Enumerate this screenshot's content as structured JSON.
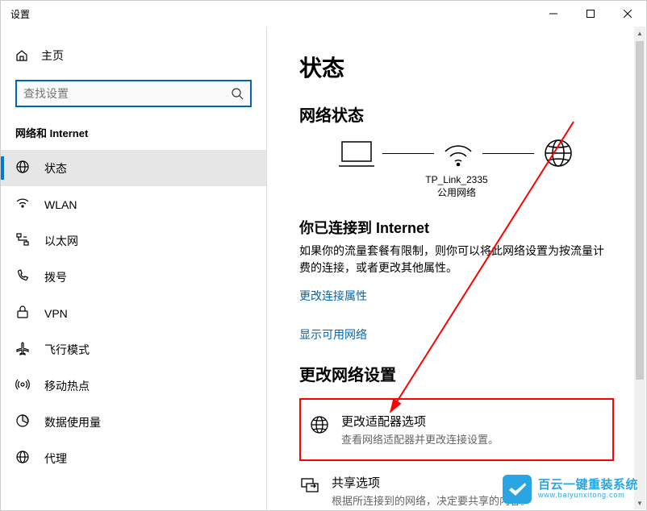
{
  "titlebar": {
    "title": "设置"
  },
  "sidebar": {
    "home_label": "主页",
    "search_placeholder": "查找设置",
    "section_title": "网络和 Internet",
    "items": [
      {
        "label": "状态",
        "icon": "status-icon",
        "active": true
      },
      {
        "label": "WLAN",
        "icon": "wlan-icon",
        "active": false
      },
      {
        "label": "以太网",
        "icon": "ethernet-icon",
        "active": false
      },
      {
        "label": "拨号",
        "icon": "dialup-icon",
        "active": false
      },
      {
        "label": "VPN",
        "icon": "vpn-icon",
        "active": false
      },
      {
        "label": "飞行模式",
        "icon": "airplane-icon",
        "active": false
      },
      {
        "label": "移动热点",
        "icon": "hotspot-icon",
        "active": false
      },
      {
        "label": "数据使用量",
        "icon": "data-usage-icon",
        "active": false
      },
      {
        "label": "代理",
        "icon": "proxy-icon",
        "active": false
      }
    ]
  },
  "main": {
    "page_title": "状态",
    "network_status_title": "网络状态",
    "network_name": "TP_Link_2335",
    "network_type": "公用网络",
    "connected_title": "你已连接到 Internet",
    "connected_desc": "如果你的流量套餐有限制，则你可以将此网络设置为按流量计费的连接，或者更改其他属性。",
    "change_connection_properties": "更改连接属性",
    "show_available_networks": "显示可用网络",
    "change_network_settings_title": "更改网络设置",
    "options": [
      {
        "title": "更改适配器选项",
        "sub": "查看网络适配器并更改连接设置。",
        "icon": "adapter-icon",
        "highlight": true
      },
      {
        "title": "共享选项",
        "sub": "根据所连接到的网络，决定要共享的内容。",
        "icon": "sharing-icon",
        "highlight": false
      }
    ]
  },
  "watermark": {
    "text": "百云一键重装系统",
    "url": "www.baiyunxitong.com"
  }
}
